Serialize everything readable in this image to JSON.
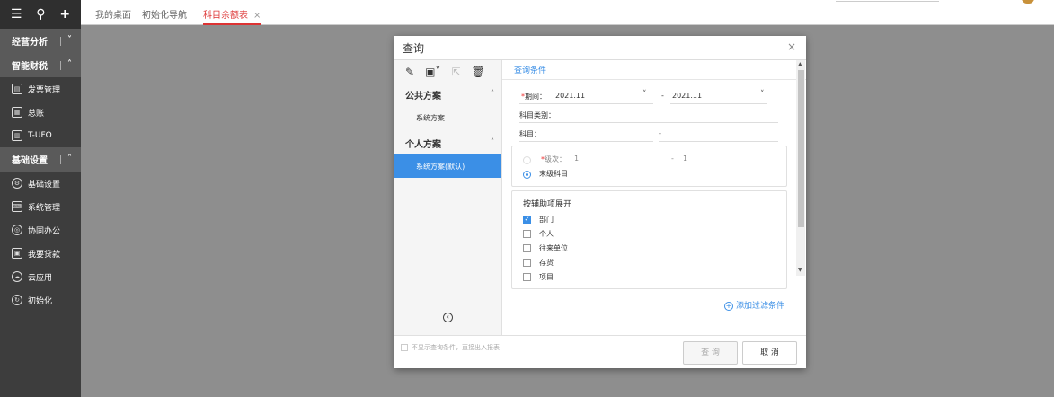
{
  "sidebar": {
    "top_icons": [
      "menu-icon",
      "search-icon",
      "plus-icon"
    ],
    "groups": [
      {
        "label": "经营分析",
        "items": []
      },
      {
        "label": "智能财税",
        "items": [
          {
            "label": "发票管理",
            "icon": "invoice-icon"
          },
          {
            "label": "总账",
            "icon": "ledger-icon"
          },
          {
            "label": "T-UFO",
            "icon": "report-icon"
          }
        ]
      },
      {
        "label": "基础设置",
        "items": [
          {
            "label": "基础设置",
            "icon": "settings-icon"
          },
          {
            "label": "系统管理",
            "icon": "system-icon"
          },
          {
            "label": "协同办公",
            "icon": "collab-icon"
          },
          {
            "label": "我要贷款",
            "icon": "loan-icon"
          },
          {
            "label": "云应用",
            "icon": "cloud-icon"
          },
          {
            "label": "初始化",
            "icon": "init-icon"
          }
        ]
      }
    ]
  },
  "tabs": [
    {
      "label": "我的桌面"
    },
    {
      "label": "初始化导航"
    },
    {
      "label": "科目余额表"
    }
  ],
  "dialog": {
    "title": "查询",
    "close": "×",
    "left": {
      "public_scheme": "公共方案",
      "public_item": "系统方案",
      "personal_scheme": "个人方案",
      "personal_item": "系统方案(默认)"
    },
    "right": {
      "tab": "查询条件",
      "period_label": "期间：",
      "period_from": "2021.11",
      "period_sep": "-",
      "period_to": "2021.11",
      "category_label": "科目类别：",
      "subject_label": "科目：",
      "subject_sep": "-",
      "level_label": "级次：",
      "level_from": "1",
      "level_sep": "-",
      "level_to": "1",
      "last_level": "末级科目",
      "aux_title": "按辅助项展开",
      "aux_items": [
        {
          "label": "部门",
          "checked": true
        },
        {
          "label": "个人",
          "checked": false
        },
        {
          "label": "往来单位",
          "checked": false
        },
        {
          "label": "存货",
          "checked": false
        },
        {
          "label": "项目",
          "checked": false
        }
      ],
      "add_filter": "添加过滤条件"
    },
    "footer": {
      "option": "不显示查询条件，直接出入报表",
      "query": "查 询",
      "cancel": "取 消"
    }
  }
}
